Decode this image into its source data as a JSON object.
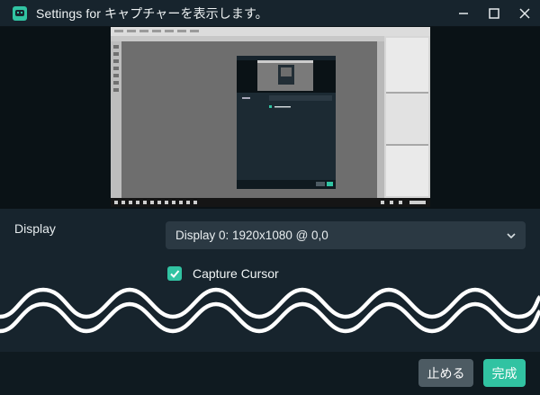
{
  "window": {
    "title": "Settings for キャプチャーを表示します。"
  },
  "settings": {
    "display_label": "Display",
    "display_value": "Display 0: 1920x1080 @ 0,0",
    "capture_cursor_label": "Capture Cursor",
    "capture_cursor_checked": true
  },
  "footer": {
    "cancel_label": "止める",
    "done_label": "完成"
  },
  "colors": {
    "accent": "#31c3a2",
    "background": "#17242d",
    "footer": "#0f1a20",
    "select_bg": "#2b3943",
    "cancel_bg": "#4d5b63"
  }
}
